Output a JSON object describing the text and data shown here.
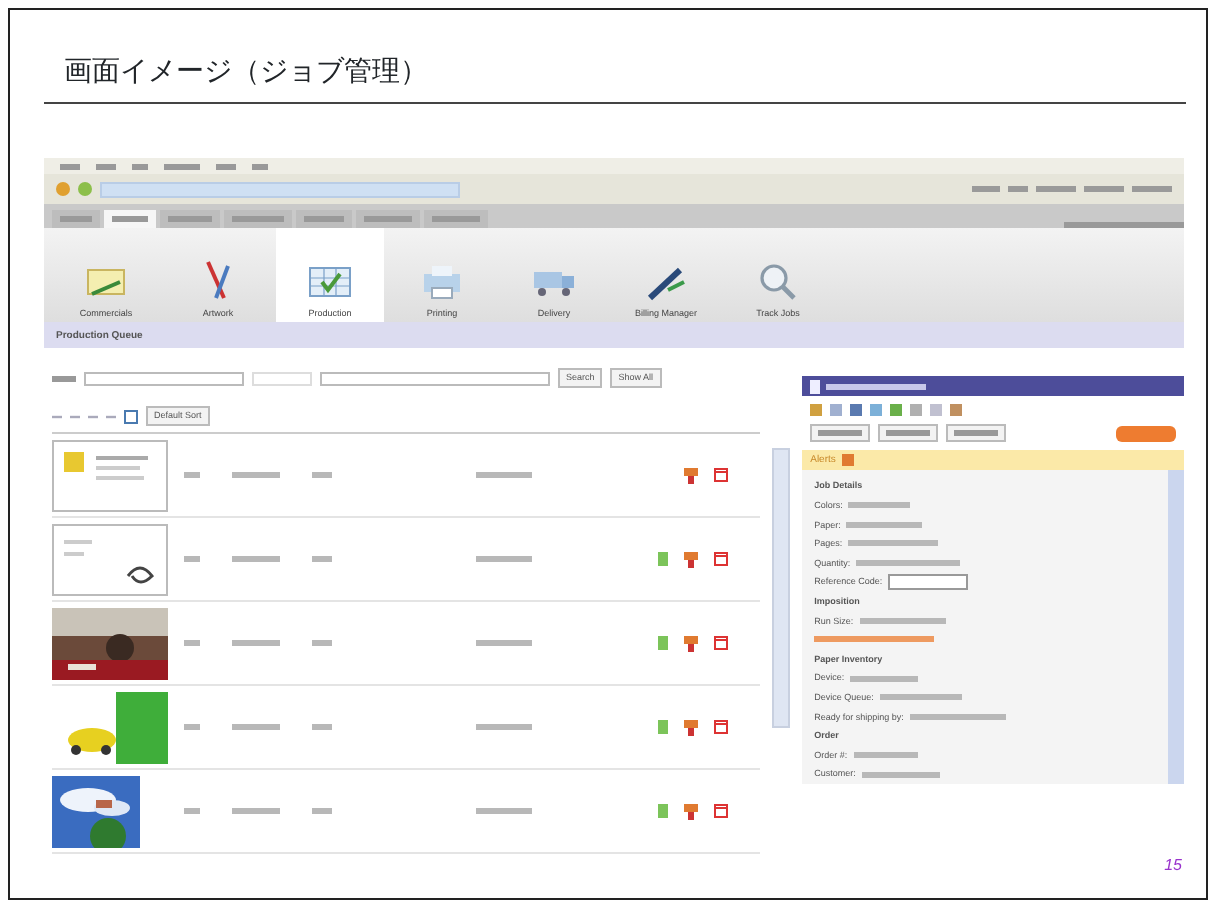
{
  "slide": {
    "title": "画面イメージ（ジョブ管理）",
    "page_number": "15"
  },
  "app": {
    "tabs": [
      {
        "selected": false
      },
      {
        "selected": true
      },
      {
        "selected": false
      },
      {
        "selected": false
      },
      {
        "selected": false
      },
      {
        "selected": false
      },
      {
        "selected": false
      }
    ],
    "tools": [
      {
        "label": "Commercials",
        "selected": false
      },
      {
        "label": "Artwork",
        "selected": false
      },
      {
        "label": "Production",
        "selected": true
      },
      {
        "label": "Printing",
        "selected": false
      },
      {
        "label": "Delivery",
        "selected": false
      },
      {
        "label": "Billing Manager",
        "selected": false
      },
      {
        "label": "Track Jobs",
        "selected": false
      }
    ],
    "queue": {
      "title": "Production Queue",
      "search_button": "Search",
      "show_all_button": "Show All",
      "sort_button": "Default Sort",
      "rows": [
        {
          "kind": "document",
          "ready": false
        },
        {
          "kind": "document",
          "ready": true
        },
        {
          "kind": "picture",
          "ready": true
        },
        {
          "kind": "picture",
          "ready": true
        },
        {
          "kind": "picture",
          "ready": true
        }
      ]
    },
    "details": {
      "alerts": "Alerts",
      "fields": [
        {
          "label": "Job Details",
          "kind": "heading"
        },
        {
          "label": "Colors:",
          "kind": "value"
        },
        {
          "label": "Paper:",
          "kind": "value"
        },
        {
          "label": "Pages:",
          "kind": "value"
        },
        {
          "label": "Quantity:",
          "kind": "value"
        },
        {
          "label": "Reference Code:",
          "kind": "input"
        },
        {
          "label": "Imposition",
          "kind": "heading"
        },
        {
          "label": "Run Size:",
          "kind": "value"
        },
        {
          "kind": "warning"
        },
        {
          "label": "Paper Inventory",
          "kind": "heading"
        },
        {
          "label": "Device:",
          "kind": "value"
        },
        {
          "label": "Device Queue:",
          "kind": "value"
        },
        {
          "label": "Ready for shipping by:",
          "kind": "value"
        },
        {
          "label": "Order",
          "kind": "heading"
        },
        {
          "label": "Order #:",
          "kind": "value"
        },
        {
          "label": "Customer:",
          "kind": "value"
        }
      ]
    }
  }
}
